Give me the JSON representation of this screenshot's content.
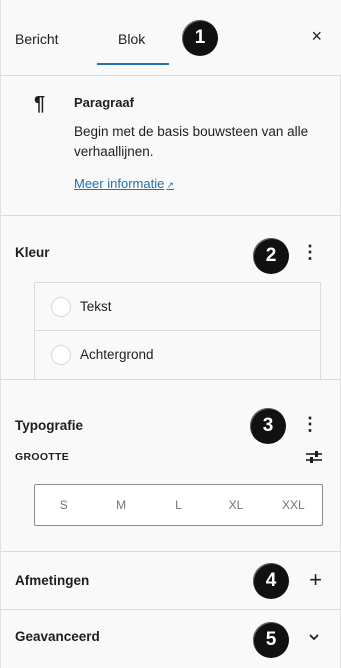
{
  "tabs": {
    "post": "Bericht",
    "block": "Blok",
    "close": "×"
  },
  "badges": [
    "1",
    "2",
    "3",
    "4",
    "5"
  ],
  "block": {
    "icon": "¶",
    "title": "Paragraaf",
    "description": "Begin met de basis bouwsteen van alle verhaallijnen.",
    "more_link": "Meer informatie",
    "more_link_icon": "external-link-icon"
  },
  "color": {
    "title": "Kleur",
    "items": [
      {
        "label": "Tekst"
      },
      {
        "label": "Achtergrond"
      }
    ]
  },
  "typography": {
    "title": "Typografie",
    "size_label": "GROOTTE",
    "sizes": [
      "S",
      "M",
      "L",
      "XL",
      "XXL"
    ]
  },
  "dimensions": {
    "title": "Afmetingen",
    "icon": "plus-icon"
  },
  "advanced": {
    "title": "Geavanceerd",
    "icon": "chevron-down-icon"
  },
  "colors": {
    "accent": "#2271b1",
    "badge": "#111111"
  }
}
